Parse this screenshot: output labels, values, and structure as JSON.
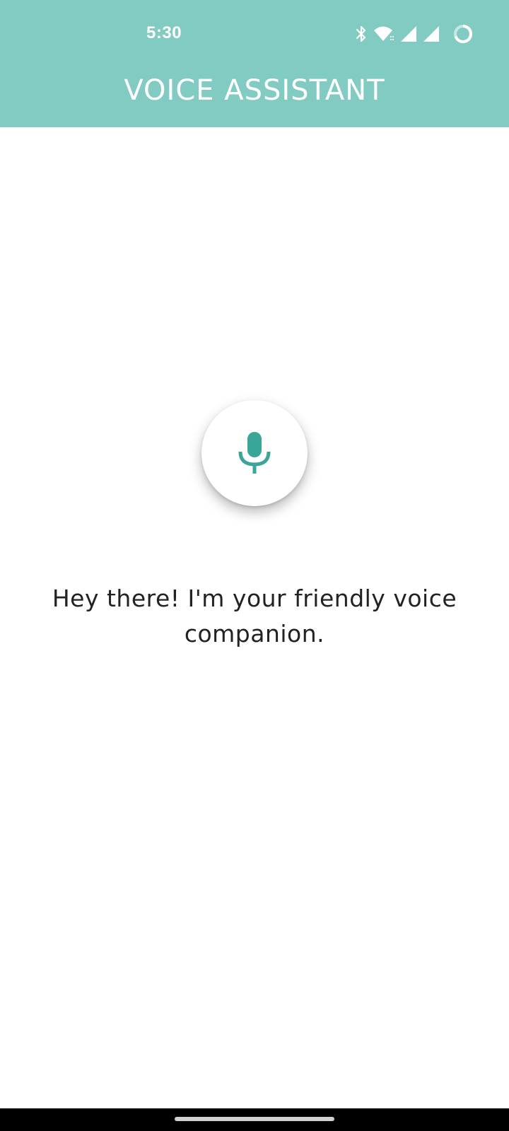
{
  "status_bar": {
    "time": "5:30",
    "icons": [
      "bluetooth-icon",
      "wifi-icon",
      "signal-icon",
      "signal-icon",
      "battery-icon"
    ]
  },
  "app_bar": {
    "title": "VOICE ASSISTANT",
    "background_color": "#82cbc3"
  },
  "mic_button": {
    "icon": "microphone-icon",
    "icon_color": "#3aa69a"
  },
  "greeting": {
    "text": "Hey there! I'm your friendly voice companion."
  }
}
